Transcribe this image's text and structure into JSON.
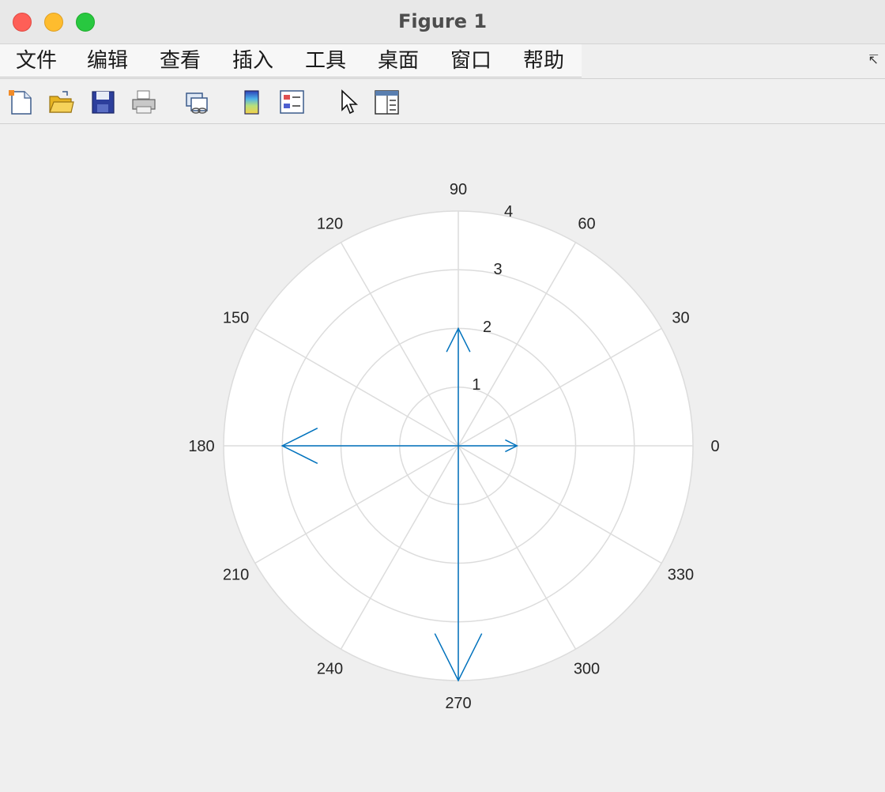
{
  "window": {
    "title": "Figure 1"
  },
  "menu": {
    "items": [
      {
        "label": "文件"
      },
      {
        "label": "编辑"
      },
      {
        "label": "查看"
      },
      {
        "label": "插入"
      },
      {
        "label": "工具"
      },
      {
        "label": "桌面"
      },
      {
        "label": "窗口"
      },
      {
        "label": "帮助"
      }
    ],
    "overflow_icon": "overflow-arrow-icon"
  },
  "toolbar": {
    "tools": [
      {
        "icon": "new-figure-icon"
      },
      {
        "icon": "open-file-icon"
      },
      {
        "icon": "save-icon"
      },
      {
        "icon": "print-icon"
      },
      {
        "icon": "link-plot-icon"
      },
      {
        "icon": "insert-colorbar-icon"
      },
      {
        "icon": "insert-legend-icon"
      },
      {
        "icon": "edit-plot-icon"
      },
      {
        "icon": "property-inspector-icon"
      }
    ]
  },
  "chart_data": {
    "type": "polar-compass",
    "theta_ticks": [
      "0",
      "30",
      "60",
      "90",
      "120",
      "150",
      "180",
      "210",
      "240",
      "270",
      "300",
      "330"
    ],
    "r_ticks": [
      "1",
      "2",
      "3",
      "4"
    ],
    "rlim": [
      0,
      4
    ],
    "grid": true,
    "series_color": "#0072bd",
    "grid_color": "#dcdcdc",
    "vectors": [
      {
        "theta_deg": 0,
        "r": 1
      },
      {
        "theta_deg": 90,
        "r": 2
      },
      {
        "theta_deg": 180,
        "r": 3
      },
      {
        "theta_deg": 270,
        "r": 4
      }
    ]
  }
}
